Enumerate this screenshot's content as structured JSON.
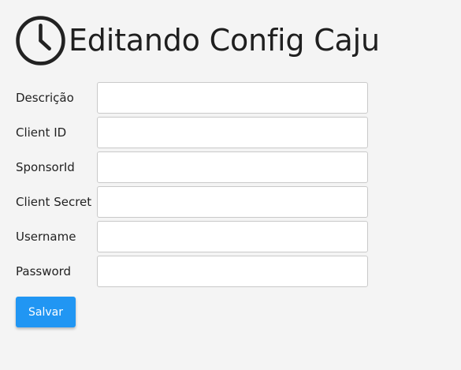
{
  "header": {
    "icon": "clock-icon",
    "title": "Editando Config Caju"
  },
  "form": {
    "fields": [
      {
        "label": "Descrição",
        "value": ""
      },
      {
        "label": "Client ID",
        "value": ""
      },
      {
        "label": "SponsorId",
        "value": ""
      },
      {
        "label": "Client Secret",
        "value": ""
      },
      {
        "label": "Username",
        "value": ""
      },
      {
        "label": "Password",
        "value": ""
      }
    ],
    "save_label": "Salvar"
  },
  "colors": {
    "background": "#f4f4f4",
    "accent": "#2196f3",
    "input_border": "#c9c9c9"
  }
}
